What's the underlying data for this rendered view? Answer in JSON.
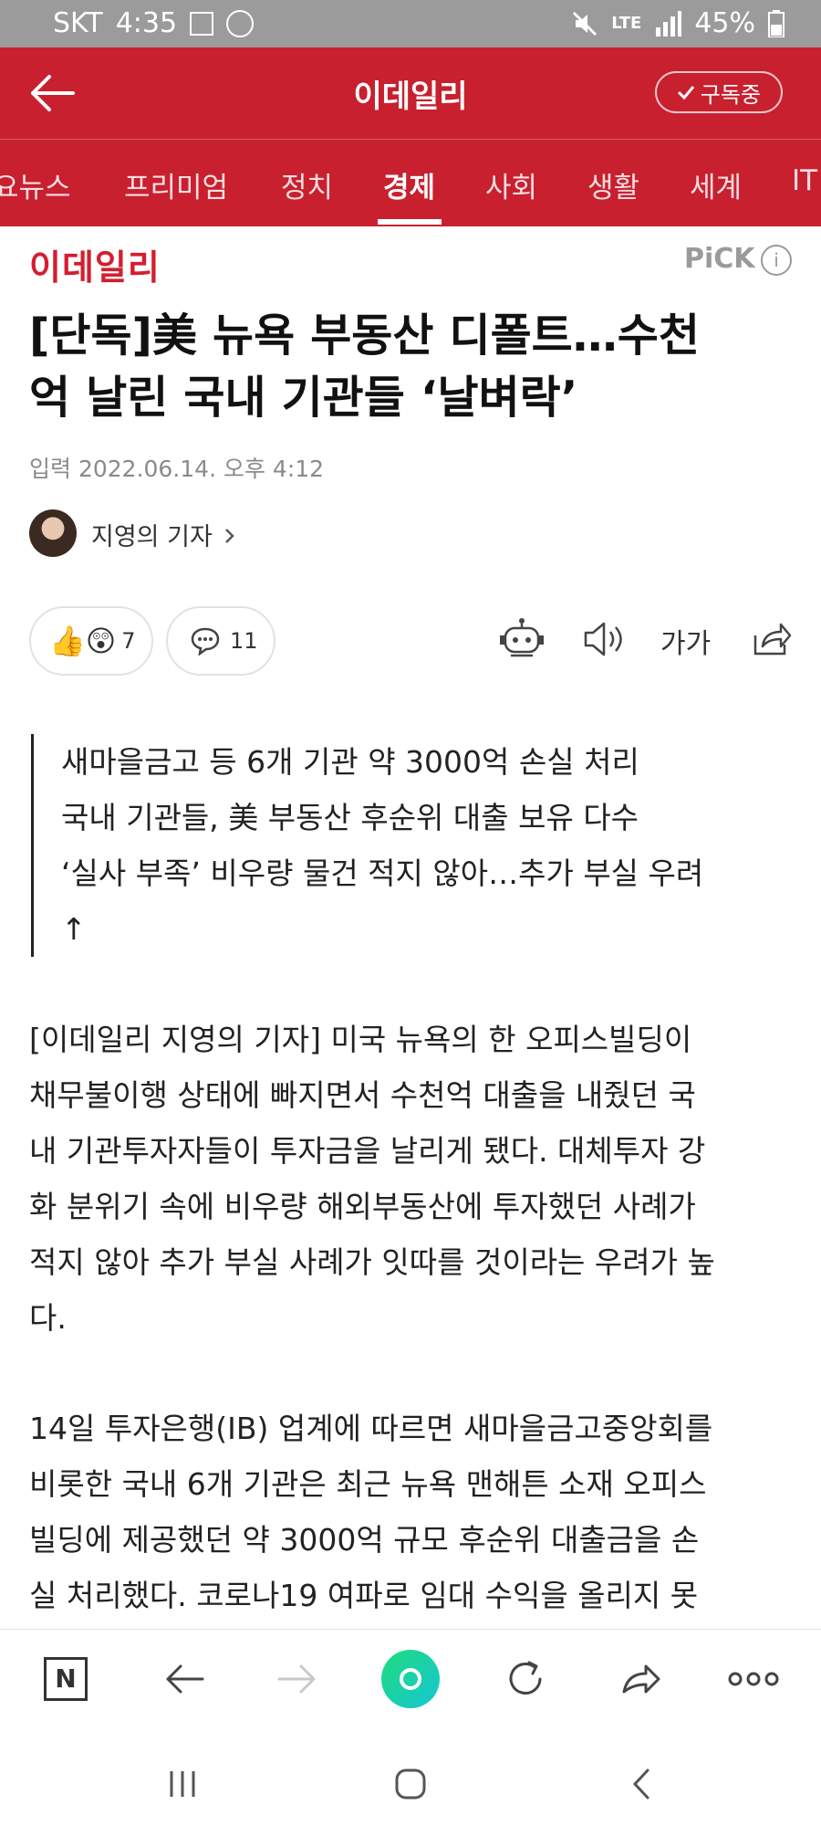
{
  "status_bar": {
    "carrier": "SKT",
    "time": "4:35",
    "network": "LTE",
    "battery": "45%"
  },
  "header": {
    "title": "이데일리",
    "subscribe_label": "구독중"
  },
  "tabs": [
    "요뉴스",
    "프리미엄",
    "정치",
    "경제",
    "사회",
    "생활",
    "세계",
    "IT"
  ],
  "article": {
    "brand": "이데일리",
    "pick_label": "PiCK",
    "headline_lines": [
      "[단독]美 뉴욕 부동산 디폴트…수천",
      "억 날린 국내 기관들 ‘날벼락’"
    ],
    "published": "입력 2022.06.14. 오후 4:12",
    "reporter": "지영의 기자",
    "like_count": "7",
    "comment_count": "11",
    "font_size_label": "가가",
    "summary_lines": [
      "새마을금고 등 6개 기관 약 3000억 손실 처리",
      "국내 기관들, 美 부동산 후순위 대출 보유 다수",
      "‘실사 부족’ 비우량 물건 적지 않아…추가 부실 우려",
      "↑"
    ],
    "paragraph1_lines": [
      "[이데일리 지영의 기자] 미국 뉴욕의 한 오피스빌딩이",
      "채무불이행 상태에 빠지면서 수천억 대출을 내줬던 국",
      "내 기관투자자들이 투자금을 날리게 됐다. 대체투자 강",
      "화 분위기 속에 비우량 해외부동산에 투자했던 사례가",
      "적지 않아 추가 부실 사례가 잇따를 것이라는 우려가 높",
      "다."
    ],
    "paragraph2_lines": [
      "14일 투자은행(IB) 업계에 따르면 새마을금고중앙회를",
      "비롯한 국내 6개 기관은 최근 뉴욕 맨해튼 소재 오피스",
      "빌딩에 제공했던 약 3000억 규모 후순위 대출금을 손",
      "실 처리했다. 코로나19 여파로 임대 수익을 올리지 못"
    ]
  },
  "browser_nav": {
    "home_label": "N"
  }
}
